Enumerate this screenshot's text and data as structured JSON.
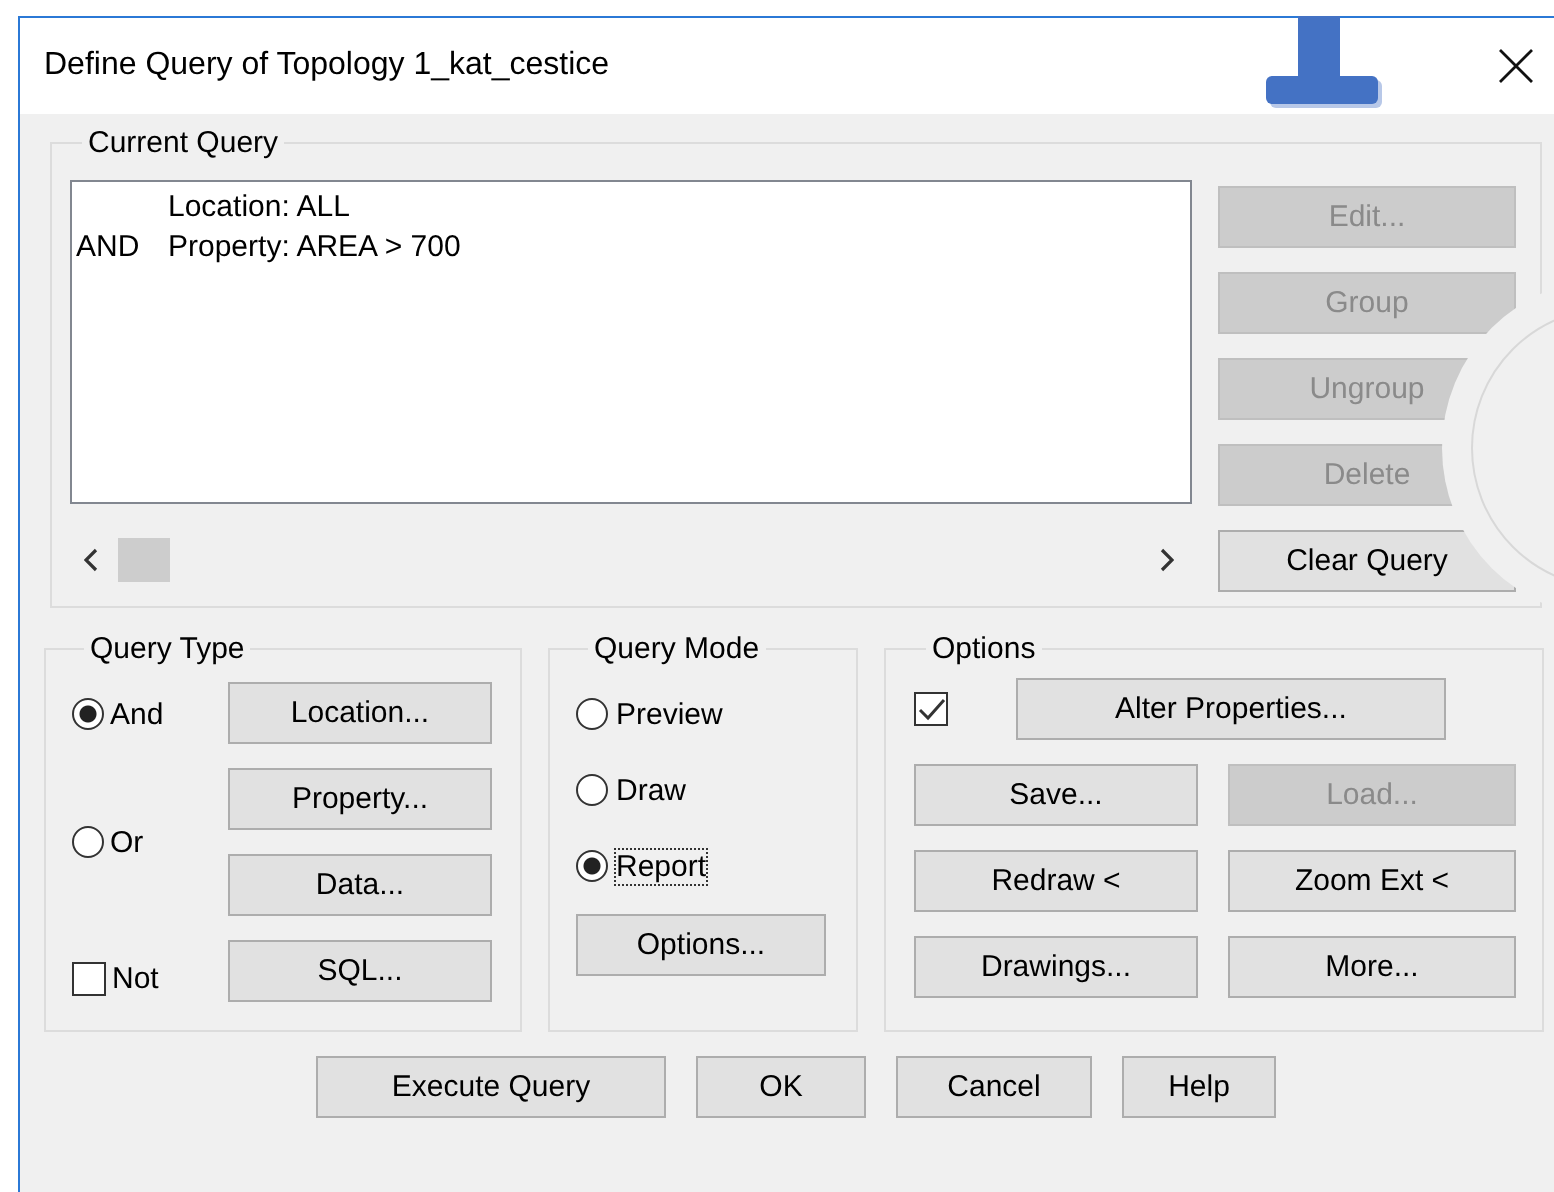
{
  "window": {
    "title": "Define Query of Topology 1_kat_cestice"
  },
  "current_query": {
    "label": "Current Query",
    "lines": [
      {
        "text": "Location: ALL"
      },
      {
        "prefix": "AND",
        "text": "Property: AREA > 700"
      }
    ],
    "buttons": [
      {
        "label": "Edit...",
        "disabled": true
      },
      {
        "label": "Group",
        "disabled": true
      },
      {
        "label": "Ungroup",
        "disabled": true
      },
      {
        "label": "Delete",
        "disabled": true
      },
      {
        "label": "Clear Query",
        "disabled": false
      }
    ]
  },
  "query_type": {
    "label": "Query Type",
    "radios": [
      {
        "label": "And",
        "selected": true
      },
      {
        "label": "Or",
        "selected": false
      }
    ],
    "not": {
      "label": "Not",
      "checked": false
    },
    "buttons": [
      {
        "label": "Location..."
      },
      {
        "label": "Property..."
      },
      {
        "label": "Data..."
      },
      {
        "label": "SQL..."
      }
    ]
  },
  "query_mode": {
    "label": "Query Mode",
    "radios": [
      {
        "label": "Preview",
        "selected": false,
        "focused": false
      },
      {
        "label": "Draw",
        "selected": false,
        "focused": false
      },
      {
        "label": "Report",
        "selected": true,
        "focused": true
      }
    ],
    "options_button": {
      "label": "Options..."
    }
  },
  "options": {
    "label": "Options",
    "alter_checked": true,
    "alter_button": {
      "label": "Alter Properties...",
      "disabled": false
    },
    "buttons": [
      {
        "label": "Save...",
        "disabled": false
      },
      {
        "label": "Load...",
        "disabled": true
      },
      {
        "label": "Redraw <",
        "disabled": false
      },
      {
        "label": "Zoom Ext <",
        "disabled": false
      },
      {
        "label": "Drawings...",
        "disabled": false
      },
      {
        "label": "More...",
        "disabled": false
      }
    ]
  },
  "footer_buttons": [
    {
      "label": "Execute Query"
    },
    {
      "label": "OK"
    },
    {
      "label": "Cancel"
    },
    {
      "label": "Help"
    }
  ]
}
